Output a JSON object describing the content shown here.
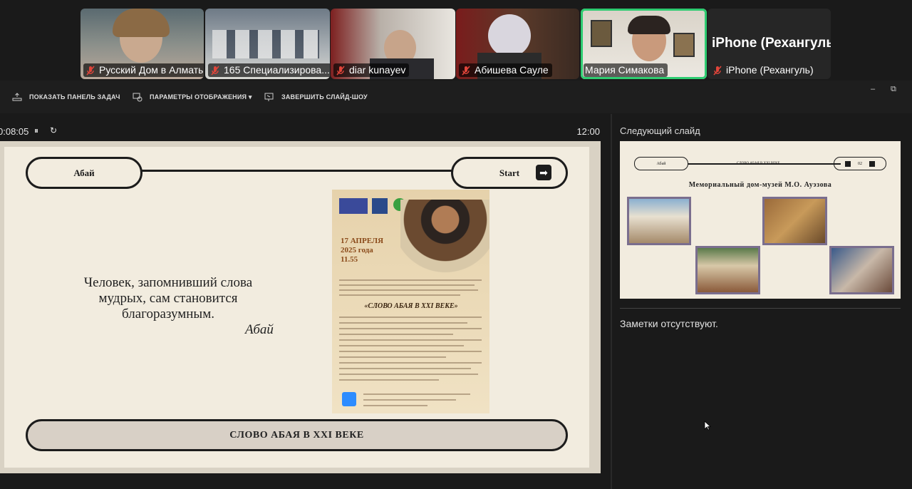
{
  "participants": [
    {
      "name": "Русский Дом в Алматы",
      "muted": true
    },
    {
      "name": "165 Специализирова...",
      "muted": true
    },
    {
      "name": "diar kunayev",
      "muted": true
    },
    {
      "name": "Абишева Сауле",
      "muted": true
    },
    {
      "name": "Мария Симакова",
      "muted": false,
      "active": true
    },
    {
      "name": "iPhone (Рехангуль)",
      "muted": true,
      "display": "iPhone  (Рехангуль)"
    }
  ],
  "toolbar": {
    "taskbar": "ПОКАЗАТЬ ПАНЕЛЬ ЗАДАЧ",
    "display_settings": "ПАРАМЕТРЫ ОТОБРАЖЕНИЯ ▾",
    "end_show": "ЗАВЕРШИТЬ СЛАЙД-ШОУ",
    "minimize": "–",
    "restore": "⧉"
  },
  "presenter": {
    "elapsed": "0:08:05",
    "pause": "⏸",
    "reset": "↻",
    "clock": "12:00",
    "next_slide_label": "Следующий слайд",
    "notes": "Заметки отсутствуют."
  },
  "slide": {
    "left_pill": "Абай",
    "start_button": "Start",
    "start_arrow": "➡",
    "quote_line1": "Человек, запомнивший слова",
    "quote_line2": "мудрых, сам становится",
    "quote_line3": "благоразумным.",
    "quote_author": "Абай",
    "bottom_title": "СЛОВО АБАЯ В XXI ВЕКЕ",
    "poster": {
      "date_line1": "17 АПРЕЛЯ",
      "date_line2": "2025 года",
      "date_line3": "11.55",
      "title": "«СЛОВО АБАЯ В XXI ВЕКЕ»"
    }
  },
  "next_slide": {
    "left_pill": "Абай",
    "center_text": "СЛОВО АБАЯ В XXI ВЕКЕ",
    "page_number": "02",
    "title": "Мемориальный дом-музей М.О. Ауэзова"
  },
  "colors": {
    "active_speaker": "#2ecc71",
    "slide_bg": "#f2ecdf",
    "muted_icon": "#e0453a"
  }
}
